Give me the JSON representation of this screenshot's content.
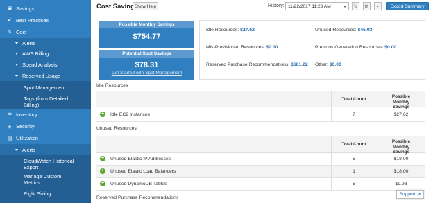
{
  "sidebar": {
    "items": [
      {
        "label": "Savings",
        "icon": "piggy-bank-icon"
      },
      {
        "label": "Best Practices",
        "icon": "check-icon"
      },
      {
        "label": "Cost",
        "icon": "dollar-icon"
      },
      {
        "label": "Alerts"
      },
      {
        "label": "AWS Billing"
      },
      {
        "label": "Spend Analysis"
      },
      {
        "label": "Reserved Usage"
      },
      {
        "label": "Spot Management"
      },
      {
        "label": "Tags (from Detailed Billing)"
      },
      {
        "label": "Inventory",
        "icon": "list-icon"
      },
      {
        "label": "Security",
        "icon": "shield-icon"
      },
      {
        "label": "Utilization",
        "icon": "chart-icon"
      },
      {
        "label": "Alerts"
      },
      {
        "label": "CloudWatch Historical Export"
      },
      {
        "label": "Manage Custom Metrics"
      },
      {
        "label": "Right Sizing"
      }
    ]
  },
  "header": {
    "title": "Cost Savings",
    "show_help": "Show Help",
    "history_label": "History:",
    "history_value": "11/22/2017 11:23 AM",
    "export_label": "Export Summary"
  },
  "summary": {
    "monthly_label": "Possible Monthly Savings",
    "monthly_value": "$754.77",
    "spot_label": "Potential Spot Savings",
    "spot_value": "$78.31",
    "spot_link": "Get Started with Spot Management"
  },
  "details": {
    "idle_label": "Idle Resources:",
    "idle_value": "$27.62",
    "unused_label": "Unused Resources:",
    "unused_value": "$45.93",
    "misprov_label": "Mis-Provisioned Resources:",
    "misprov_value": "$0.00",
    "prevgen_label": "Previous Generation Resources:",
    "prevgen_value": "$0.00",
    "rpr_label": "Reserved Purchase Recommendations:",
    "rpr_value": "$681.22",
    "other_label": "Other:",
    "other_value": "$0.00"
  },
  "table_headers": {
    "total_count": "Total Count",
    "possible_savings": "Possible Monthly Savings"
  },
  "idle": {
    "title": "Idle Resources",
    "rows": [
      {
        "name": "Idle EC2 Instances",
        "count": "7",
        "savings": "$27.62"
      }
    ]
  },
  "unused": {
    "title": "Unused Resources",
    "rows": [
      {
        "name": "Unused Elastic IP Addresses",
        "count": "5",
        "savings": "$18.00"
      },
      {
        "name": "Unused Elastic Load Balancers",
        "count": "1",
        "savings": "$18.00"
      },
      {
        "name": "Unused DynamoDB Tables",
        "count": "5",
        "savings": "$9.93"
      }
    ]
  },
  "reserved": {
    "title": "Reserved Purchase Recommendations"
  },
  "support_label": "Support"
}
